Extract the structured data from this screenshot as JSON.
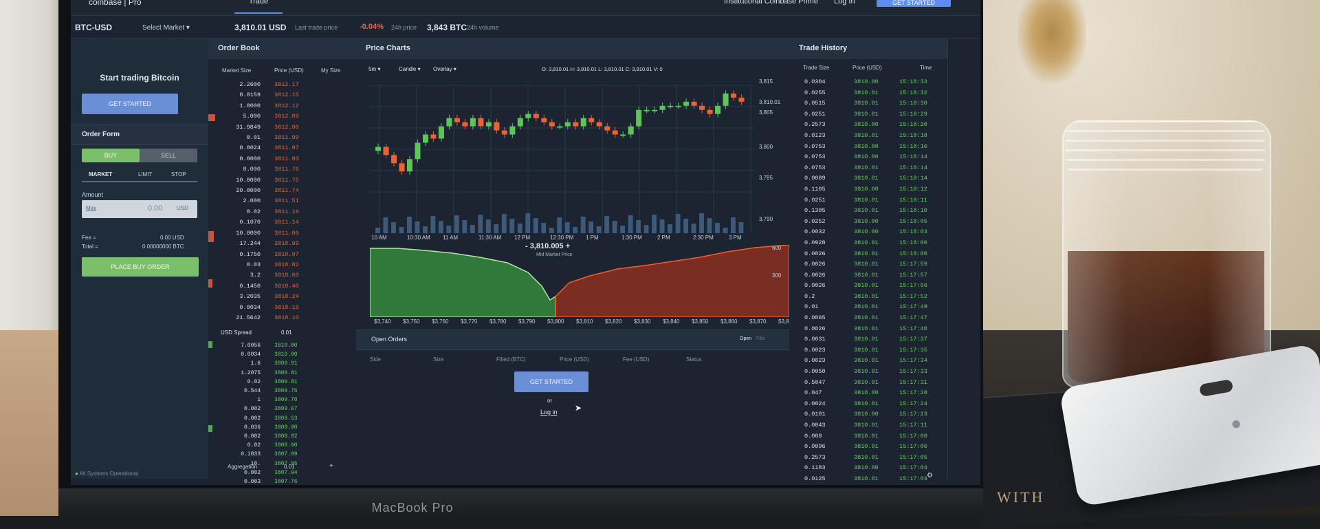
{
  "scene": {
    "device_label": "MacBook Pro",
    "book_text": "WITH"
  },
  "header": {
    "brand": "coinbase | Pro",
    "tab_trade": "Trade",
    "institutional": "Institutional Coinbase Prime",
    "login": "Log In",
    "get_started": "GET STARTED"
  },
  "market": {
    "pair": "BTC-USD",
    "select_market": "Select Market",
    "last_price": "3,810.01 USD",
    "last_price_label": "Last trade price",
    "change": "-0.04%",
    "change_label": "24h price",
    "volume": "3,843 BTC",
    "volume_label": "24h volume"
  },
  "sidebar": {
    "start_title": "Start trading Bitcoin",
    "get_started": "GET STARTED",
    "order_form": "Order Form",
    "buy": "BUY",
    "sell": "SELL",
    "tab_market": "MARKET",
    "tab_limit": "LIMIT",
    "tab_stop": "STOP",
    "amount_label": "Amount",
    "amount_max": "Max",
    "amount_value": "0.00",
    "amount_unit": "USD",
    "fee_label": "Fee =",
    "fee_value": "0.00 USD",
    "total_label": "Total =",
    "total_value": "0.00000000 BTC",
    "place_order": "PLACE BUY ORDER",
    "status": "All Systems Operational"
  },
  "orderbook": {
    "title": "Order Book",
    "col_market_size": "Market Size",
    "col_price": "Price (USD)",
    "col_my_size": "My Size",
    "asks_sizes": "2.2600\n0.0159\n1.0000\n5.000\n31.9849\n0.01\n0.0024\n0.0000\n8.000\n10.0000\n20.0000\n2.000\n0.02\n0.1070\n10.0000\n17.244\n0.1750\n0.03\n3.2\n0.1450\n3.2035\n0.0034\n21.5642",
    "asks_prices": "3812.17\n3812.15\n3812.12\n3812.09\n3812.00\n3811.99\n3811.97\n3811.93\n3811.76\n3811.75\n3811.74\n3811.51\n3811.16\n3811.14\n3811.00\n3810.99\n3810.97\n3810.82\n3810.60\n3810.40\n3810.24\n3810.16\n3810.10",
    "spread_label": "USD Spread",
    "spread_value": "0.01",
    "bids_sizes": "7.0056\n0.0034\n1.6\n1.2075\n0.02\n0.544\n1\n0.002\n0.002\n0.036\n0.002\n0.02\n0.1833\n10.\n0.002\n0.003\n0.002\n0.003\n0.01\n0.01",
    "bids_prices": "3810.00\n3810.00\n3809.91\n3809.81\n3809.81\n3809.75\n3809.70\n3809.67\n3809.53\n3809.00\n3808.92\n3808.00\n3807.99\n3807.95\n3807.94\n3807.76\n3807.51\n3807.50\n3807.27\n3807.20",
    "aggregation_label": "Aggregation",
    "aggregation_value": "0.01"
  },
  "chart": {
    "title": "Price Charts",
    "interval": "5m",
    "style": "Candle",
    "overlay": "Overlay",
    "ohlcv": "O: 3,810.01  H: 3,810.01  L: 3,810.01  C: 3,810.01  V: 0",
    "mid_price": "3,810.005",
    "mid_label": "Mid Market Price",
    "open_orders": "Open Orders",
    "open_tab": "Open",
    "fills_tab": "Fills",
    "cols": [
      "Side",
      "Size",
      "Filled (BTC)",
      "Price (USD)",
      "Fee (USD)",
      "Status"
    ],
    "get_started": "GET STARTED",
    "or": "or",
    "login": "Log in"
  },
  "chart_data": {
    "type": "candlestick",
    "price_ticks": [
      "3,815",
      "3,805",
      "3,800",
      "3,795",
      "3,790"
    ],
    "last_label": "3,810.01",
    "time_ticks": [
      "10 AM",
      "10:30 AM",
      "11 AM",
      "11:30 AM",
      "12 PM",
      "12:30 PM",
      "1 PM",
      "1:30 PM",
      "2 PM",
      "2:30 PM",
      "3 PM"
    ],
    "closes": [
      3801,
      3799,
      3797,
      3795,
      3798,
      3802,
      3804,
      3803,
      3806,
      3808,
      3807,
      3806,
      3808,
      3806,
      3807,
      3805,
      3804,
      3806,
      3808,
      3809,
      3808,
      3807,
      3806,
      3806,
      3807,
      3806,
      3808,
      3807,
      3806,
      3805,
      3804,
      3804,
      3806,
      3810,
      3810,
      3810,
      3811,
      3811,
      3811,
      3812,
      3811,
      3810,
      3809,
      3811,
      3814,
      3813,
      3812
    ],
    "depth_ticks": [
      "$3,740",
      "$3,750",
      "$3,760",
      "$3,770",
      "$3,780",
      "$3,790",
      "$3,800",
      "$3,810",
      "$3,820",
      "$3,830",
      "$3,840",
      "$3,850",
      "$3,860",
      "$3,870",
      "$3,880"
    ],
    "depth_y": [
      "600",
      "300"
    ],
    "colors": {
      "up": "#5ec45a",
      "down": "#e8623a",
      "bid_fill": "#2f7a3a",
      "ask_fill": "#7a2d22"
    }
  },
  "trades": {
    "title": "Trade History",
    "col_size": "Trade Size",
    "col_price": "Price (USD)",
    "col_time": "Time",
    "sizes": "0.0304\n0.0255\n0.0515\n0.0251\n0.2573\n0.0123\n0.0753\n0.0753\n0.0753\n0.0089\n0.1105\n0.0251\n0.1305\n0.0252\n0.0032\n0.0928\n0.0026\n0.0026\n0.0026\n0.0026\n0.2\n0.01\n0.0065\n0.0026\n0.0031\n0.0023\n0.0023\n0.0050\n0.5047\n0.047\n0.0024\n0.0101\n0.0043\n0.008\n0.0096\n0.2573\n0.1183\n0.0125\n0.0058\n0.0054\n0.0024\n0.0100\n0.0105\n0.1029",
    "prices": "3810.00\n3810.01\n3810.01\n3810.01\n3810.00\n3810.01\n3810.00\n3810.00\n3810.01\n3810.01\n3810.00\n3810.01\n3810.01\n3810.00\n3810.00\n3810.01\n3810.01\n3810.01\n3810.01\n3810.01\n3810.01\n3810.01\n3810.01\n3810.01\n3810.01\n3810.01\n3810.01\n3810.01\n3810.01\n3810.00\n3810.01\n3810.00\n3810.01\n3810.01\n3810.01\n3810.01\n3810.00\n3810.01\n3810.01\n3810.01\n3810.01\n3810.01\n3810.01\n3810.01",
    "times": "15:18:33\n15:18:32\n15:18:30\n15:18:29\n15:18:20\n15:18:18\n15:18:16\n15:18:14\n15:18:14\n15:18:14\n15:18:12\n15:18:11\n15:18:10\n15:18:05\n15:18:03\n15:18:00\n15:18:00\n15:17:59\n15:17:57\n15:17:56\n15:17:52\n15:17:49\n15:17:47\n15:17:40\n15:17:37\n15:17:35\n15:17:34\n15:17:33\n15:17:31\n15:17:28\n15:17:24\n15:17:23\n15:17:11\n15:17:08\n15:17:06\n15:17:05\n15:17:04\n15:17:03\n15:17:02\n15:17:00\n15:16:58\n15:16:56\n15:16:55\n15:16:54"
  }
}
